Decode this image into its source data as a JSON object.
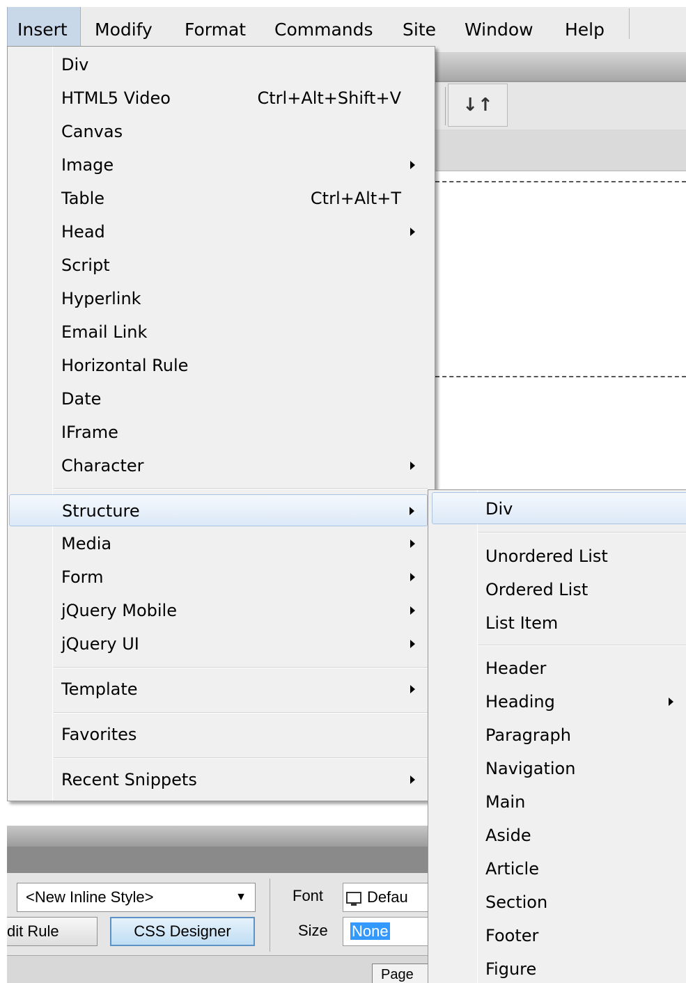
{
  "menubar": {
    "items": [
      {
        "label": "Insert",
        "active": true
      },
      {
        "label": "Modify"
      },
      {
        "label": "Format"
      },
      {
        "label": "Commands"
      },
      {
        "label": "Site"
      },
      {
        "label": "Window"
      },
      {
        "label": "Help"
      }
    ]
  },
  "insert_menu": {
    "items": [
      {
        "label": "Div",
        "shortcut": "",
        "submenu": false
      },
      {
        "label": "HTML5 Video",
        "shortcut": "Ctrl+Alt+Shift+V",
        "submenu": false
      },
      {
        "label": "Canvas",
        "shortcut": "",
        "submenu": false
      },
      {
        "label": "Image",
        "shortcut": "",
        "submenu": true
      },
      {
        "label": "Table",
        "shortcut": "Ctrl+Alt+T",
        "submenu": false
      },
      {
        "label": "Head",
        "shortcut": "",
        "submenu": true
      },
      {
        "label": "Script",
        "shortcut": "",
        "submenu": false
      },
      {
        "label": "Hyperlink",
        "shortcut": "",
        "submenu": false
      },
      {
        "label": "Email Link",
        "shortcut": "",
        "submenu": false
      },
      {
        "label": "Horizontal Rule",
        "shortcut": "",
        "submenu": false
      },
      {
        "label": "Date",
        "shortcut": "",
        "submenu": false
      },
      {
        "label": "IFrame",
        "shortcut": "",
        "submenu": false
      },
      {
        "label": "Character",
        "shortcut": "",
        "submenu": true
      },
      {
        "label": "Structure",
        "shortcut": "",
        "submenu": true,
        "highlighted": true
      },
      {
        "label": "Media",
        "shortcut": "",
        "submenu": true
      },
      {
        "label": "Form",
        "shortcut": "",
        "submenu": true
      },
      {
        "label": "jQuery Mobile",
        "shortcut": "",
        "submenu": true
      },
      {
        "label": "jQuery UI",
        "shortcut": "",
        "submenu": true
      },
      {
        "label": "Template",
        "shortcut": "",
        "submenu": true
      },
      {
        "label": "Favorites",
        "shortcut": "",
        "submenu": false
      },
      {
        "label": "Recent Snippets",
        "shortcut": "",
        "submenu": true
      }
    ]
  },
  "structure_menu": {
    "items": [
      {
        "label": "Div",
        "submenu": false,
        "highlighted": true
      },
      {
        "label": "Unordered List",
        "submenu": false
      },
      {
        "label": "Ordered List",
        "submenu": false
      },
      {
        "label": "List Item",
        "submenu": false
      },
      {
        "label": "Header",
        "submenu": false
      },
      {
        "label": "Heading",
        "submenu": true
      },
      {
        "label": "Paragraph",
        "submenu": false
      },
      {
        "label": "Navigation",
        "submenu": false
      },
      {
        "label": "Main",
        "submenu": false
      },
      {
        "label": "Aside",
        "submenu": false
      },
      {
        "label": "Article",
        "submenu": false
      },
      {
        "label": "Section",
        "submenu": false
      },
      {
        "label": "Footer",
        "submenu": false
      },
      {
        "label": "Figure",
        "submenu": false
      }
    ]
  },
  "toolbar": {
    "sort_icon": "↓↑",
    "sort_icon_name": "sort-icon"
  },
  "properties": {
    "style_select": "<New Inline Style>",
    "edit_rule_label": "dit Rule",
    "css_designer_label": "CSS Designer",
    "font_label": "Font",
    "font_value": "Defau",
    "size_label": "Size",
    "size_value": "None",
    "page_props_label": "Page"
  }
}
